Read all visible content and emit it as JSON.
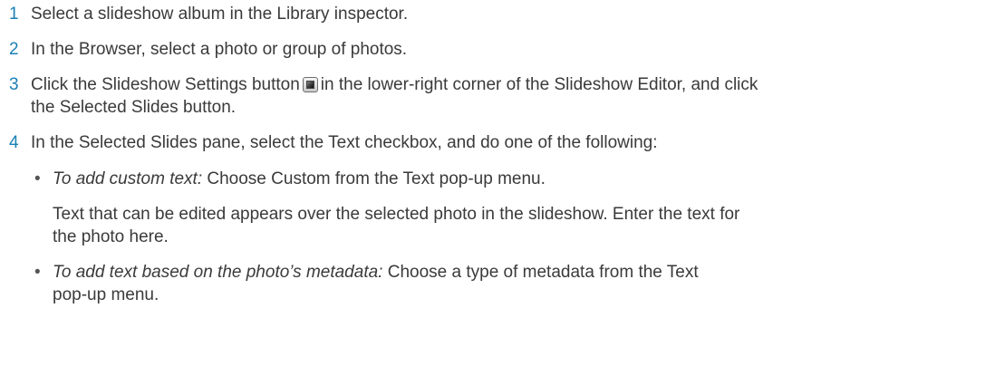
{
  "steps": [
    {
      "number": "1",
      "lines": [
        "Select a slideshow album in the Library inspector."
      ]
    },
    {
      "number": "2",
      "lines": [
        "In the Browser, select a photo or group of photos."
      ]
    },
    {
      "number": "3",
      "line1_before_icon": "Click the Slideshow Settings button",
      "icon": "slideshow-settings-icon",
      "line1_after_icon": "in the lower-right corner of the Slideshow Editor, and click",
      "line2": "the Selected Slides button."
    },
    {
      "number": "4",
      "lines": [
        "In the Selected Slides pane, select the Text checkbox, and do one of the following:"
      ]
    }
  ],
  "bullets": [
    {
      "marker": "•",
      "label": "To add custom text:",
      "text": " Choose Custom from the Text pop-up menu.",
      "continuation": [
        "Text that can be edited appears over the selected photo in the slideshow. Enter the text for",
        "the photo here."
      ]
    },
    {
      "marker": "•",
      "label": "To add text based on the photo’s metadata:",
      "text": " Choose a type of metadata from the Text",
      "continuation": [
        "pop-up menu."
      ]
    }
  ],
  "colors": {
    "step_number": "#1a7fb5",
    "body_text": "#3a3a3a"
  }
}
